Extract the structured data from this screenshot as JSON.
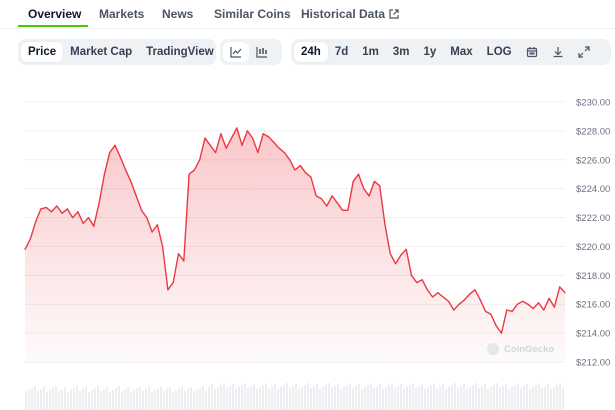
{
  "tabs": [
    {
      "label": "Overview"
    },
    {
      "label": "Markets"
    },
    {
      "label": "News"
    },
    {
      "label": "Similar Coins"
    },
    {
      "label": "Historical Data"
    }
  ],
  "toolbar": {
    "metric": [
      "Price",
      "Market Cap",
      "TradingView"
    ],
    "metric_selected": "Price",
    "view_icons": [
      "line-chart-icon",
      "candlestick-icon"
    ],
    "ranges": [
      "24h",
      "7d",
      "1m",
      "3m",
      "1y",
      "Max",
      "LOG"
    ],
    "range_selected": "24h",
    "action_icons": [
      "calendar-icon",
      "download-icon",
      "expand-icon"
    ]
  },
  "watermark": "CoinGecko",
  "colors": {
    "line": "#ea3943",
    "fill": "#ea3943",
    "accent": "#4bcc00",
    "grid": "#e5e7eb"
  },
  "chart_data": {
    "type": "area",
    "ylim": [
      212,
      230
    ],
    "y_ticks": [
      "$230.00",
      "$228.00",
      "$226.00",
      "$224.00",
      "$222.00",
      "$220.00",
      "$218.00",
      "$216.00",
      "$214.00",
      "$212.00"
    ],
    "y_tick_values": [
      230,
      228,
      226,
      224,
      222,
      220,
      218,
      216,
      214,
      212
    ],
    "values": [
      219.8,
      220.5,
      221.7,
      222.6,
      222.7,
      222.4,
      222.8,
      222.3,
      222.6,
      222.0,
      222.4,
      221.6,
      222.0,
      221.4,
      223.0,
      225.0,
      226.5,
      227.0,
      226.2,
      225.3,
      224.5,
      223.5,
      222.5,
      222.0,
      221.0,
      221.5,
      220.0,
      217.0,
      217.5,
      219.5,
      219.0,
      225.0,
      225.3,
      226.0,
      227.5,
      227.0,
      226.5,
      227.8,
      226.8,
      227.5,
      228.2,
      227.0,
      228.0,
      227.5,
      226.5,
      227.8,
      227.6,
      227.2,
      226.8,
      226.5,
      226.0,
      225.3,
      225.6,
      225.1,
      224.8,
      223.5,
      223.3,
      222.8,
      223.5,
      223.0,
      222.5,
      222.5,
      224.5,
      225.0,
      224.0,
      223.5,
      224.5,
      224.2,
      221.5,
      219.5,
      218.8,
      219.4,
      219.8,
      218.0,
      217.5,
      217.7,
      217.0,
      216.5,
      216.8,
      216.5,
      216.2,
      215.6,
      216.0,
      216.3,
      216.7,
      217.0,
      216.3,
      215.5,
      215.3,
      214.5,
      214.0,
      215.6,
      215.5,
      216.0,
      216.2,
      216.0,
      215.7,
      216.1,
      215.6,
      216.4,
      215.8,
      217.2,
      216.8
    ]
  }
}
